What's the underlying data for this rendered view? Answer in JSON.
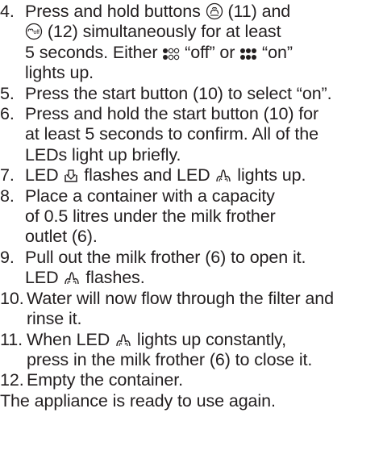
{
  "steps": [
    {
      "number": "4.",
      "lines": [
        {
          "a": "Press and hold buttons ",
          "icon1": "steam-swirl-circle-icon",
          "b": " (11) and"
        },
        {
          "icon1": "steam-off-circle-icon",
          "b": " (12) simultaneously for at least"
        },
        {
          "a": "5 seconds. Either ",
          "icon1": "dots-1-of-3-icon",
          "b": " “off” or ",
          "icon2": "dots-3-of-3-icon",
          "c": " “on”"
        },
        {
          "a": "lights up."
        }
      ]
    },
    {
      "number": "5.",
      "lines": [
        {
          "a": "Press the start button (10) to select “on”."
        }
      ]
    },
    {
      "number": "6.",
      "lines": [
        {
          "a": "Press and hold the start button (10) for"
        },
        {
          "a": "at least 5 seconds to confirm. All of the"
        },
        {
          "a": "LEDs light up briefly."
        }
      ]
    },
    {
      "number": "7.",
      "lines": [
        {
          "a": "LED ",
          "icon1": "filter-cartridge-icon",
          "b": " flashes and LED ",
          "icon2": "steam-icon",
          "c": " lights up."
        }
      ]
    },
    {
      "number": "8.",
      "lines": [
        {
          "a": "Place a container with a capacity"
        },
        {
          "a": "of 0.5 litres under the milk frother"
        },
        {
          "a": "outlet (6)."
        }
      ]
    },
    {
      "number": "9.",
      "lines": [
        {
          "a": "Pull out the milk frother (6) to open it."
        },
        {
          "a": "LED ",
          "icon1": "steam-icon",
          "b": " flashes."
        }
      ]
    },
    {
      "number": "10.",
      "lines": [
        {
          "a": "Water will now flow through the filter and"
        },
        {
          "a": "rinse it."
        }
      ]
    },
    {
      "number": "11.",
      "lines": [
        {
          "a": "When LED ",
          "icon1": "steam-icon",
          "b": " lights up constantly,"
        },
        {
          "a": "press in the milk frother (6) to close it."
        }
      ]
    },
    {
      "number": "12.",
      "lines": [
        {
          "a": "Empty the container."
        }
      ]
    }
  ],
  "footer": "The appliance is ready to use again."
}
